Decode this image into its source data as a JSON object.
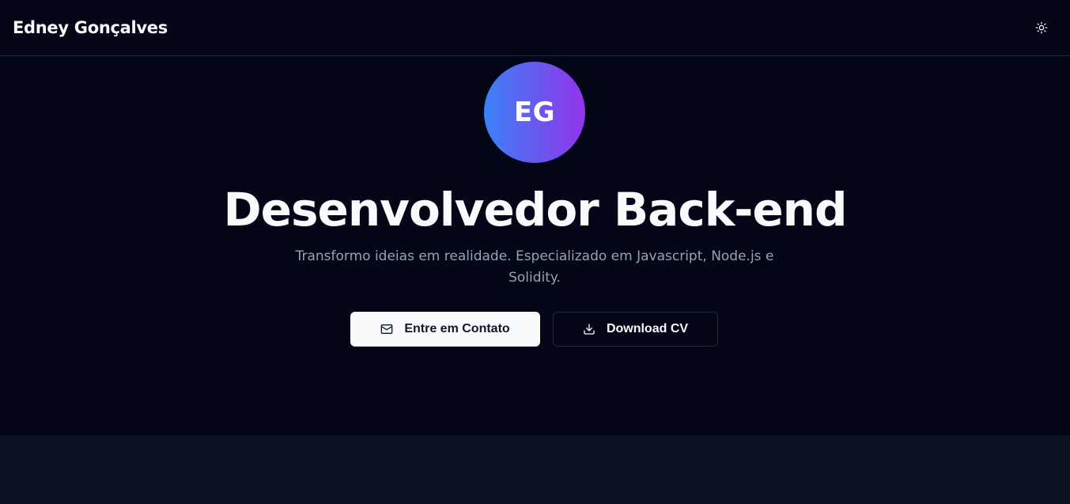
{
  "header": {
    "brand": "Edney Gonçalves",
    "theme_toggle_icon": "sun-icon"
  },
  "hero": {
    "avatar_initials": "EG",
    "avatar_gradient": [
      "#3b82f6",
      "#9333ea"
    ],
    "title": "Desenvolvedor Back-end",
    "subtitle": "Transformo ideias em realidade. Especializado em Javascript, Node.js e Solidity.",
    "contact_button": {
      "label": "Entre em Contato",
      "icon": "mail-icon"
    },
    "download_button": {
      "label": "Download CV",
      "icon": "download-icon"
    }
  },
  "colors": {
    "background": "#020617",
    "lower_section": "#0b1120",
    "muted_text": "#94a3b8",
    "border": "#1e293b"
  }
}
